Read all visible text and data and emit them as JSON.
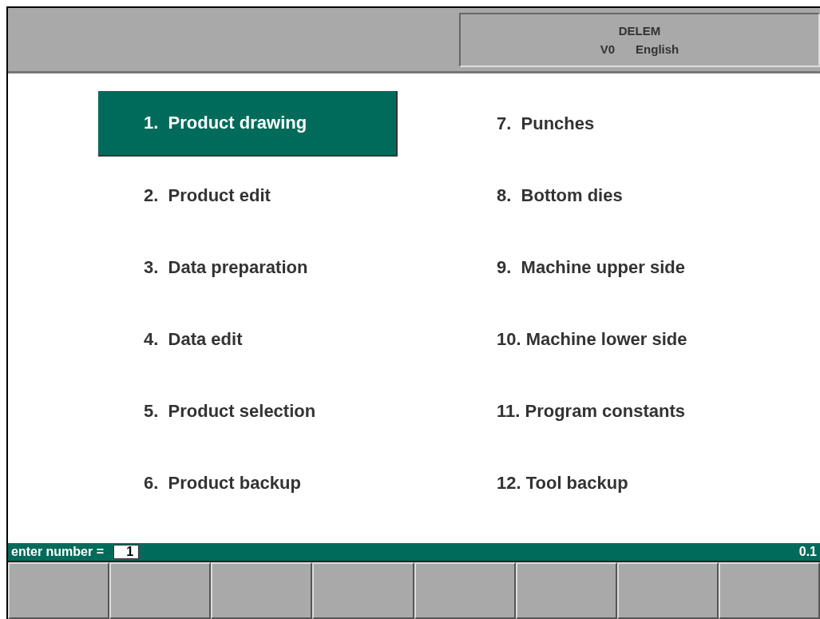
{
  "header": {
    "brand": "DELEM",
    "version": "V0",
    "language": "English"
  },
  "menu": {
    "columns": [
      [
        {
          "label": "1.  Product drawing",
          "selected": true
        },
        {
          "label": "2.  Product edit",
          "selected": false
        },
        {
          "label": "3.  Data preparation",
          "selected": false
        },
        {
          "label": "4.  Data edit",
          "selected": false
        },
        {
          "label": "5.  Product selection",
          "selected": false
        },
        {
          "label": "6.  Product backup",
          "selected": false
        }
      ],
      [
        {
          "label": "7.  Punches",
          "selected": false
        },
        {
          "label": "8.  Bottom dies",
          "selected": false
        },
        {
          "label": "9.  Machine upper side",
          "selected": false
        },
        {
          "label": "10. Machine lower side",
          "selected": false
        },
        {
          "label": "11. Program constants",
          "selected": false
        },
        {
          "label": "12. Tool backup",
          "selected": false
        }
      ]
    ]
  },
  "status_bar": {
    "prompt": "enter number =",
    "value": "1",
    "version": "0.1"
  },
  "softkeys": [
    {
      "kind": "blank"
    },
    {
      "kind": "blank"
    },
    {
      "kind": "blank"
    },
    {
      "kind": "blank"
    },
    {
      "kind": "blank"
    },
    {
      "kind": "blank"
    },
    {
      "kind": "blank"
    },
    {
      "kind": "blank"
    }
  ]
}
